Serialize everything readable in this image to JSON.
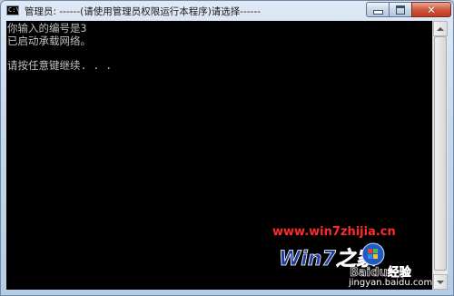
{
  "window": {
    "title": "管理员: ------(请使用管理员权限运行本程序)请选择------",
    "app_icon_text": "C:\\"
  },
  "console": {
    "lines": [
      "你输入的编号是3",
      "已启动承载网络。",
      "",
      "请按任意键继续. . ."
    ]
  },
  "watermark": {
    "url": "www.win7zhijia.cn",
    "logo_text": "Win7之家",
    "baidu_text": "Baidu经验",
    "site": "jingyan.baidu.com"
  }
}
